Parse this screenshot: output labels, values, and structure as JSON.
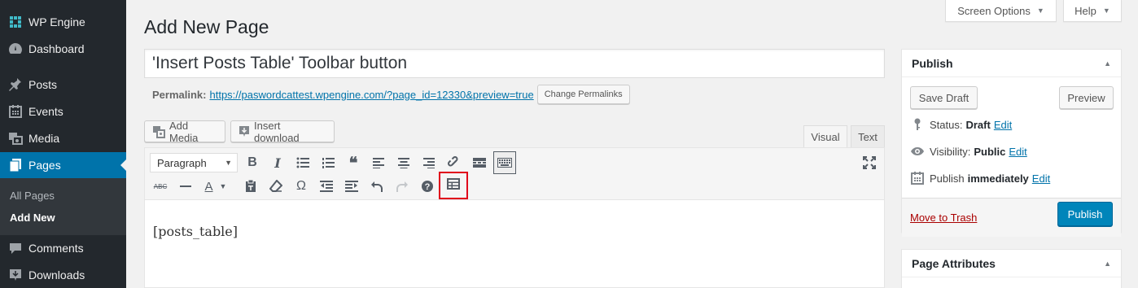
{
  "sidebar": {
    "items": [
      {
        "label": "WP Engine",
        "icon": "wp-engine-icon"
      },
      {
        "label": "Dashboard",
        "icon": "dashboard-icon"
      },
      {
        "label": "Posts",
        "icon": "pin-icon"
      },
      {
        "label": "Events",
        "icon": "calendar-icon"
      },
      {
        "label": "Media",
        "icon": "media-icon"
      },
      {
        "label": "Pages",
        "icon": "pages-icon"
      },
      {
        "label": "Comments",
        "icon": "comments-icon"
      },
      {
        "label": "Downloads",
        "icon": "download-icon"
      }
    ],
    "submenu": [
      "All Pages",
      "Add New"
    ]
  },
  "top": {
    "screen_options": "Screen Options",
    "help": "Help"
  },
  "heading": "Add New Page",
  "title_value": "'Insert Posts Table' Toolbar button",
  "permalink": {
    "label": "Permalink:",
    "url": "https://paswordcattest.wpengine.com/?page_id=12330&preview=true",
    "change_button": "Change Permalinks"
  },
  "media": {
    "add_media": "Add Media",
    "insert_download": "Insert download"
  },
  "editor": {
    "tab_visual": "Visual",
    "tab_text": "Text",
    "format_select": "Paragraph",
    "content": "[posts_table]"
  },
  "publish_box": {
    "title": "Publish",
    "save_draft": "Save Draft",
    "preview": "Preview",
    "status_label": "Status:",
    "status_value": "Draft",
    "visibility_label": "Visibility:",
    "visibility_value": "Public",
    "publish_label": "Publish",
    "publish_value": "immediately",
    "edit": "Edit",
    "move_to_trash": "Move to Trash",
    "publish_button": "Publish"
  },
  "attributes_box": {
    "title": "Page Attributes"
  },
  "colors": {
    "sidebar_bg": "#23282d",
    "active_menu": "#0073aa",
    "primary_button": "#0085ba",
    "highlight_border": "#e0001b",
    "link": "#0073aa",
    "trash": "#aa0000"
  }
}
